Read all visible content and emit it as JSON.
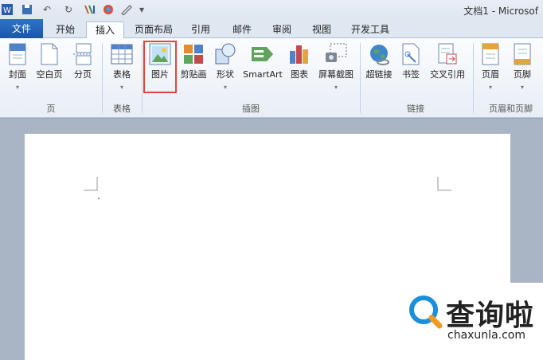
{
  "window": {
    "title": "文档1 - Microsof"
  },
  "quick_access": {
    "undo_glyph": "↶",
    "redo_glyph": "↻"
  },
  "tabs": [
    {
      "label": "文件"
    },
    {
      "label": "开始"
    },
    {
      "label": "插入"
    },
    {
      "label": "页面布局"
    },
    {
      "label": "引用"
    },
    {
      "label": "邮件"
    },
    {
      "label": "审阅"
    },
    {
      "label": "视图"
    },
    {
      "label": "开发工具"
    }
  ],
  "ribbon": {
    "groups": {
      "pages": "页",
      "tables": "表格",
      "illustrations": "插图",
      "links": "链接",
      "header_footer": "页眉和页脚"
    },
    "buttons": {
      "cover": "封面",
      "blank_page": "空白页",
      "page_break": "分页",
      "table": "表格",
      "picture": "图片",
      "clipart": "剪贴画",
      "shapes": "形状",
      "smartart": "SmartArt",
      "chart": "图表",
      "screenshot": "屏幕截图",
      "hyperlink": "超链接",
      "bookmark": "书签",
      "cross_reference": "交叉引用",
      "header": "页眉",
      "footer": "页脚"
    },
    "dropdown_glyph": "▾"
  },
  "watermark": {
    "brand_cn": "查询啦",
    "url": "chaxunla.com"
  },
  "colors": {
    "file_tab": "#1c57a8",
    "highlight": "#e0453b",
    "workspace": "#a9b5c4"
  }
}
